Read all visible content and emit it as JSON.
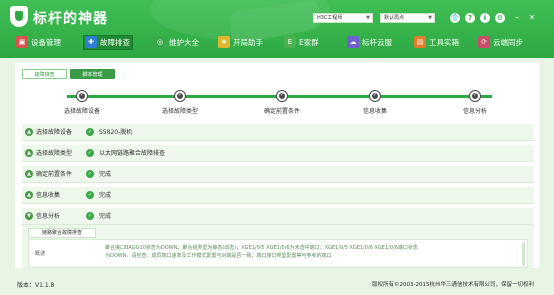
{
  "app": {
    "title": "标杆的神器",
    "logo_icon": "shield-logo-icon"
  },
  "topbar": {
    "vendor_select": "H3C工程师",
    "dept_select": "默认局点",
    "icons": [
      "shirt-icon",
      "help-icon",
      "info-icon",
      "settings-icon"
    ],
    "window_buttons": [
      "minimize",
      "close"
    ]
  },
  "nav": {
    "tabs": [
      {
        "label": "设备管理",
        "icon": "device-icon",
        "color": "#d9534f",
        "active": false
      },
      {
        "label": "故障排查",
        "icon": "fault-icon",
        "color": "#2e7fd3",
        "active": true
      },
      {
        "label": "维护大全",
        "icon": "maintain-icon",
        "color": "#3aa848",
        "active": false
      },
      {
        "label": "开局助手",
        "icon": "assistant-icon",
        "color": "#e0b72a",
        "active": false
      },
      {
        "label": "E家群",
        "icon": "group-icon",
        "color": "#4caf50",
        "active": false
      },
      {
        "label": "标杆云服",
        "icon": "cloud-service-icon",
        "color": "#6f5fd0",
        "active": false
      },
      {
        "label": "工具实箱",
        "icon": "toolbox-icon",
        "color": "#e07c2a",
        "active": false
      },
      {
        "label": "云端同步",
        "icon": "sync-icon",
        "color": "#c94d6a",
        "active": false
      }
    ]
  },
  "subtabs": {
    "fault": "故障排查",
    "script": "脚本管理"
  },
  "steps": [
    "选择故障设备",
    "选择故障类型",
    "确定前置条件",
    "信息收集",
    "信息分析"
  ],
  "rows": [
    {
      "label": "选择故障设备",
      "value": "S5820-脱机"
    },
    {
      "label": "选择故障类型",
      "value": "以太网链路聚合故障排查"
    },
    {
      "label": "确定前置条件",
      "value": "完成"
    },
    {
      "label": "信息收集",
      "value": "完成"
    },
    {
      "label": "信息分析",
      "value": "完成"
    }
  ],
  "detail": {
    "tab_label": "链路聚合故障排查",
    "row_label": "概述",
    "text_line1": "聚合接口BAGG10状态为DOWN；聚合组类型为静态(动态)；XGE1/0/5 XGE1/0/6为未选中端口；XGE1/0/5 XGE1/0/6 XGE1/0/6端口状态",
    "text_line2": "为DOWN，请检查：成员端口速率及工作模式配置与对端是否一致；端口接口类型配置等可参考的端口"
  },
  "footer": {
    "version": "版本：V1.1.8",
    "copyright": "版权所有©2003-2015杭州华三通信技术有限公司，保留一切权利"
  }
}
